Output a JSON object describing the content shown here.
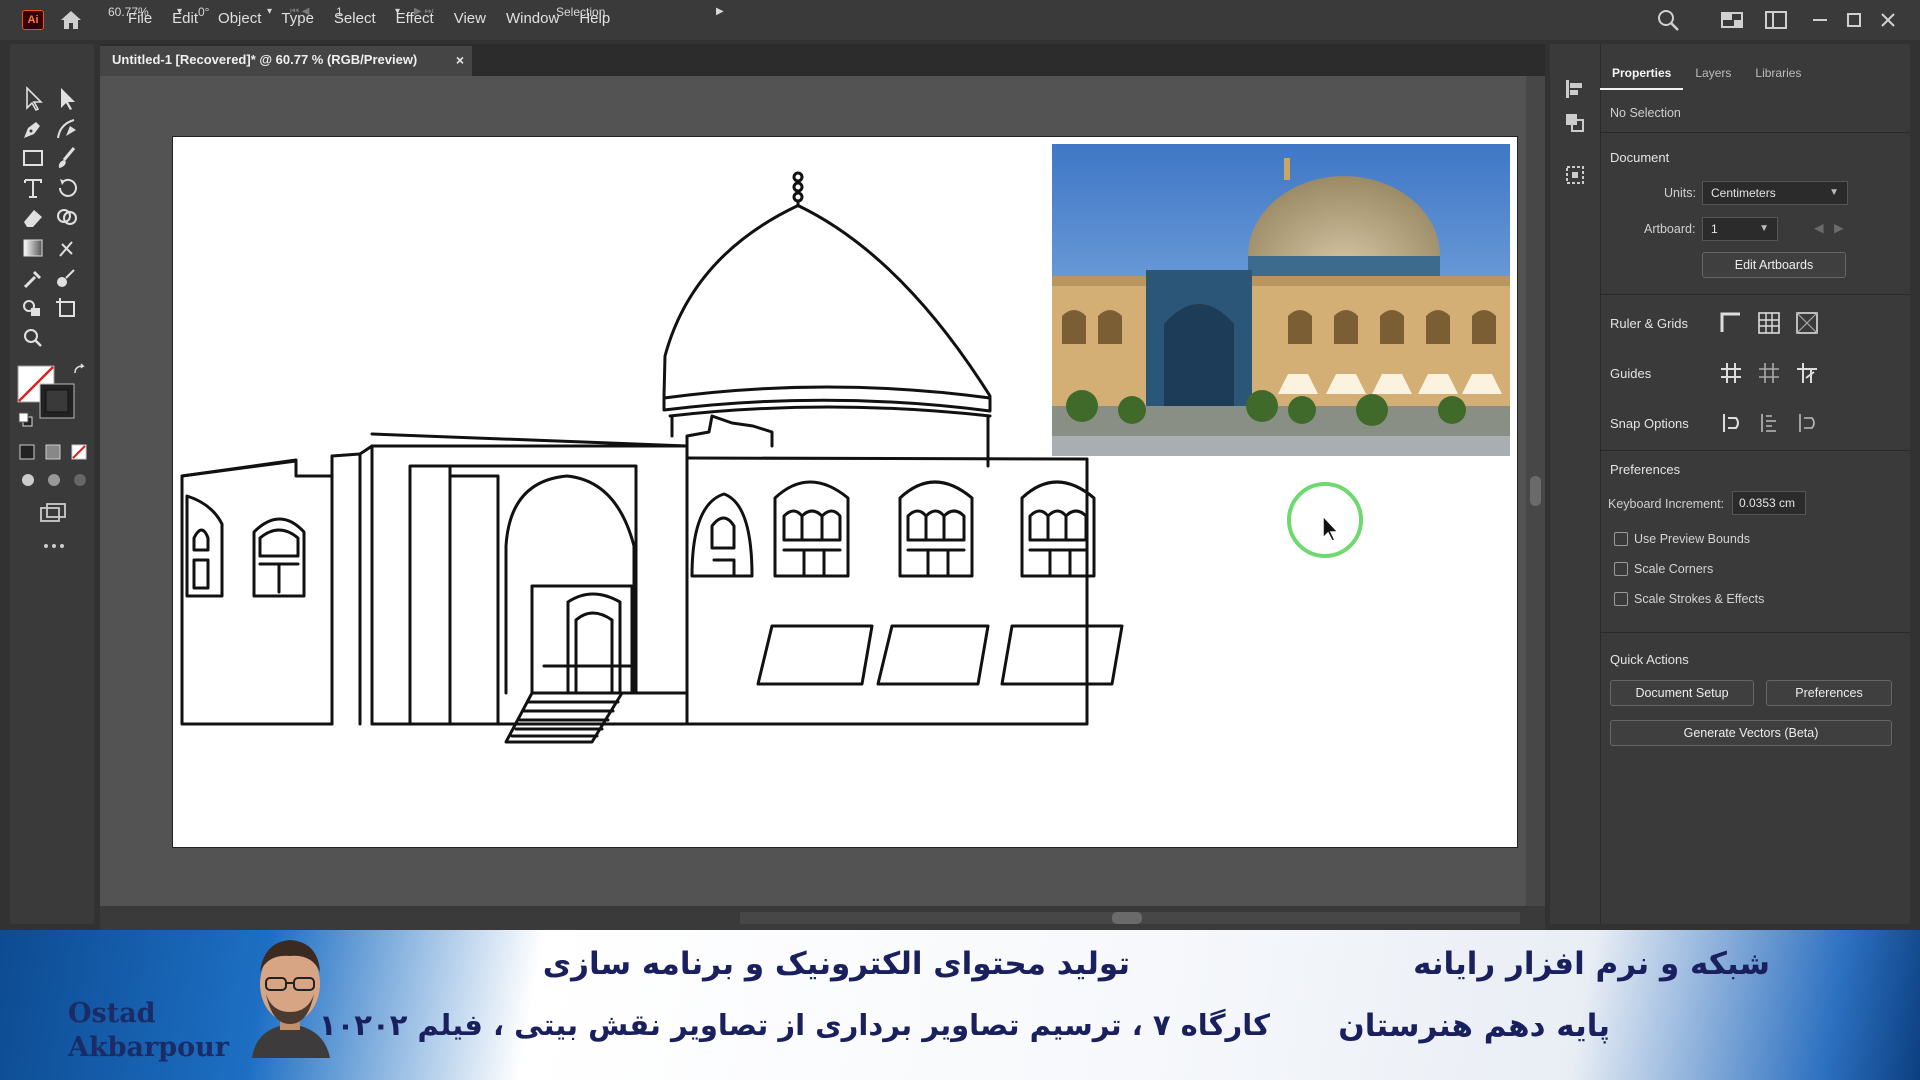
{
  "app": {
    "logo_text": "Ai",
    "menus": [
      "File",
      "Edit",
      "Object",
      "Type",
      "Select",
      "Effect",
      "View",
      "Window",
      "Help"
    ]
  },
  "document": {
    "tab_title": "Untitled-1 [Recovered]* @ 60.77 % (RGB/Preview)",
    "close_glyph": "×"
  },
  "status": {
    "zoom": "60.77%",
    "rotation": "0°",
    "artboard_number": "1",
    "tool_name": "Selection"
  },
  "panel": {
    "tabs": [
      "Properties",
      "Layers",
      "Libraries"
    ],
    "no_selection": "No Selection",
    "document_section": "Document",
    "units_label": "Units:",
    "units_value": "Centimeters",
    "artboard_label": "Artboard:",
    "artboard_value": "1",
    "edit_artboards": "Edit Artboards",
    "ruler_grids": "Ruler & Grids",
    "guides": "Guides",
    "snap_options": "Snap Options",
    "preferences_section": "Preferences",
    "keyboard_increment_label": "Keyboard Increment:",
    "keyboard_increment_value": "0.0353 cm",
    "use_preview_bounds": "Use Preview Bounds",
    "scale_corners": "Scale Corners",
    "scale_strokes": "Scale Strokes & Effects",
    "quick_actions": "Quick Actions",
    "document_setup": "Document Setup",
    "preferences_btn": "Preferences",
    "generate_vectors": "Generate Vectors (Beta)"
  },
  "banner": {
    "title_right": "شبکه و نرم افزار رایانه",
    "title_center": "تولید محتوای الکترونیک و برنامه سازی",
    "subtitle_right": "پایه دهم هنرستان",
    "subtitle_center": "کارگاه ۷ ، ترسیم تصاویر برداری از تصاویر نقش بیتی ، فیلم ۱۰۲۰۲",
    "brand_line1": "Ostad",
    "brand_line2": "Akbarpour"
  },
  "colors": {
    "chrome_dark": "#323232",
    "panel": "#3a3a3a",
    "canvas": "#535353",
    "cursor_ring": "#6fd86f",
    "logo_orange": "#ff7a3d"
  }
}
